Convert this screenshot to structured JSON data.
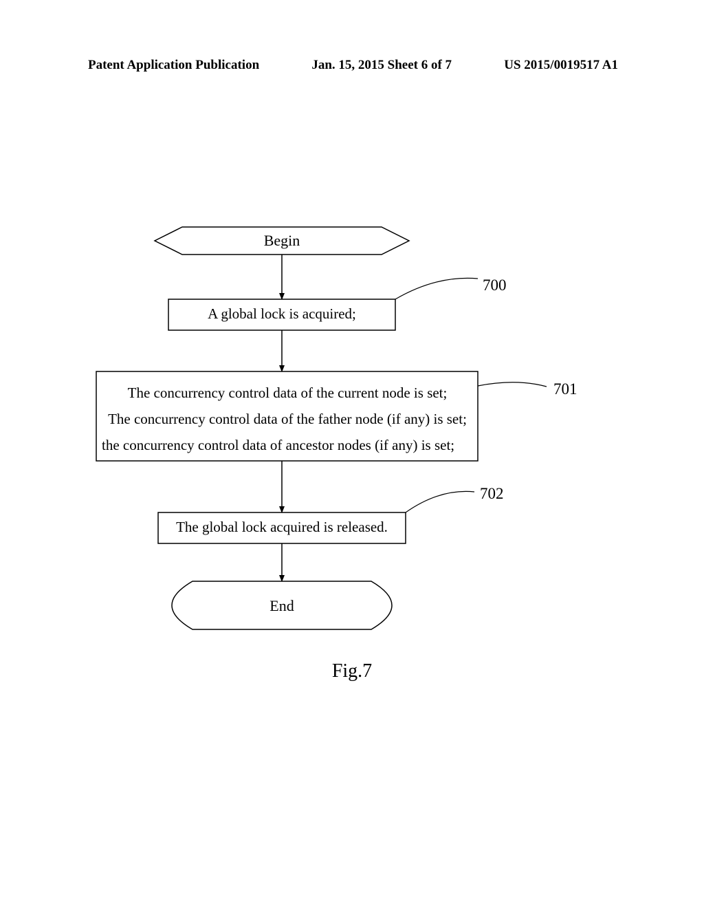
{
  "header": {
    "left": "Patent Application Publication",
    "center": "Jan. 15, 2015  Sheet 6 of 7",
    "right": "US 2015/0019517 A1"
  },
  "flowchart": {
    "begin": "Begin",
    "step_700": "A global lock is acquired;",
    "label_700": "700",
    "step_701_line1": "The concurrency control data of the current node is set;",
    "step_701_line2": "The concurrency control data of the father node (if any) is set;",
    "step_701_line3": "the concurrency control data of ancestor nodes (if any) is set;",
    "label_701": "701",
    "step_702": "The global lock acquired is released.",
    "label_702": "702",
    "end": "End"
  },
  "caption": "Fig.7"
}
